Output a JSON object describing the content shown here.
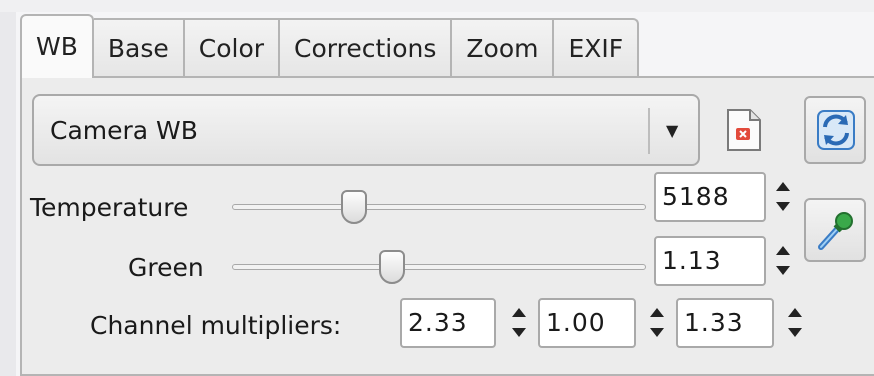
{
  "tabs": [
    {
      "label": "WB",
      "active": true
    },
    {
      "label": "Base",
      "active": false
    },
    {
      "label": "Color",
      "active": false
    },
    {
      "label": "Corrections",
      "active": false
    },
    {
      "label": "Zoom",
      "active": false
    },
    {
      "label": "EXIF",
      "active": false
    }
  ],
  "wb_preset": {
    "value": "Camera WB"
  },
  "temperature": {
    "label": "Temperature",
    "value": "5188",
    "slider_fraction": 0.28
  },
  "green": {
    "label": "Green",
    "value": "1.13",
    "slider_fraction": 0.38
  },
  "channel_multipliers": {
    "label": "Channel multipliers:",
    "values": [
      "2.33",
      "1.00",
      "1.33"
    ]
  },
  "icons": {
    "document": "document-icon",
    "refresh": "refresh-icon",
    "picker": "eyedropper-icon"
  },
  "colors": {
    "accent": "#3a7cc5",
    "panel_bg": "#ececec"
  }
}
